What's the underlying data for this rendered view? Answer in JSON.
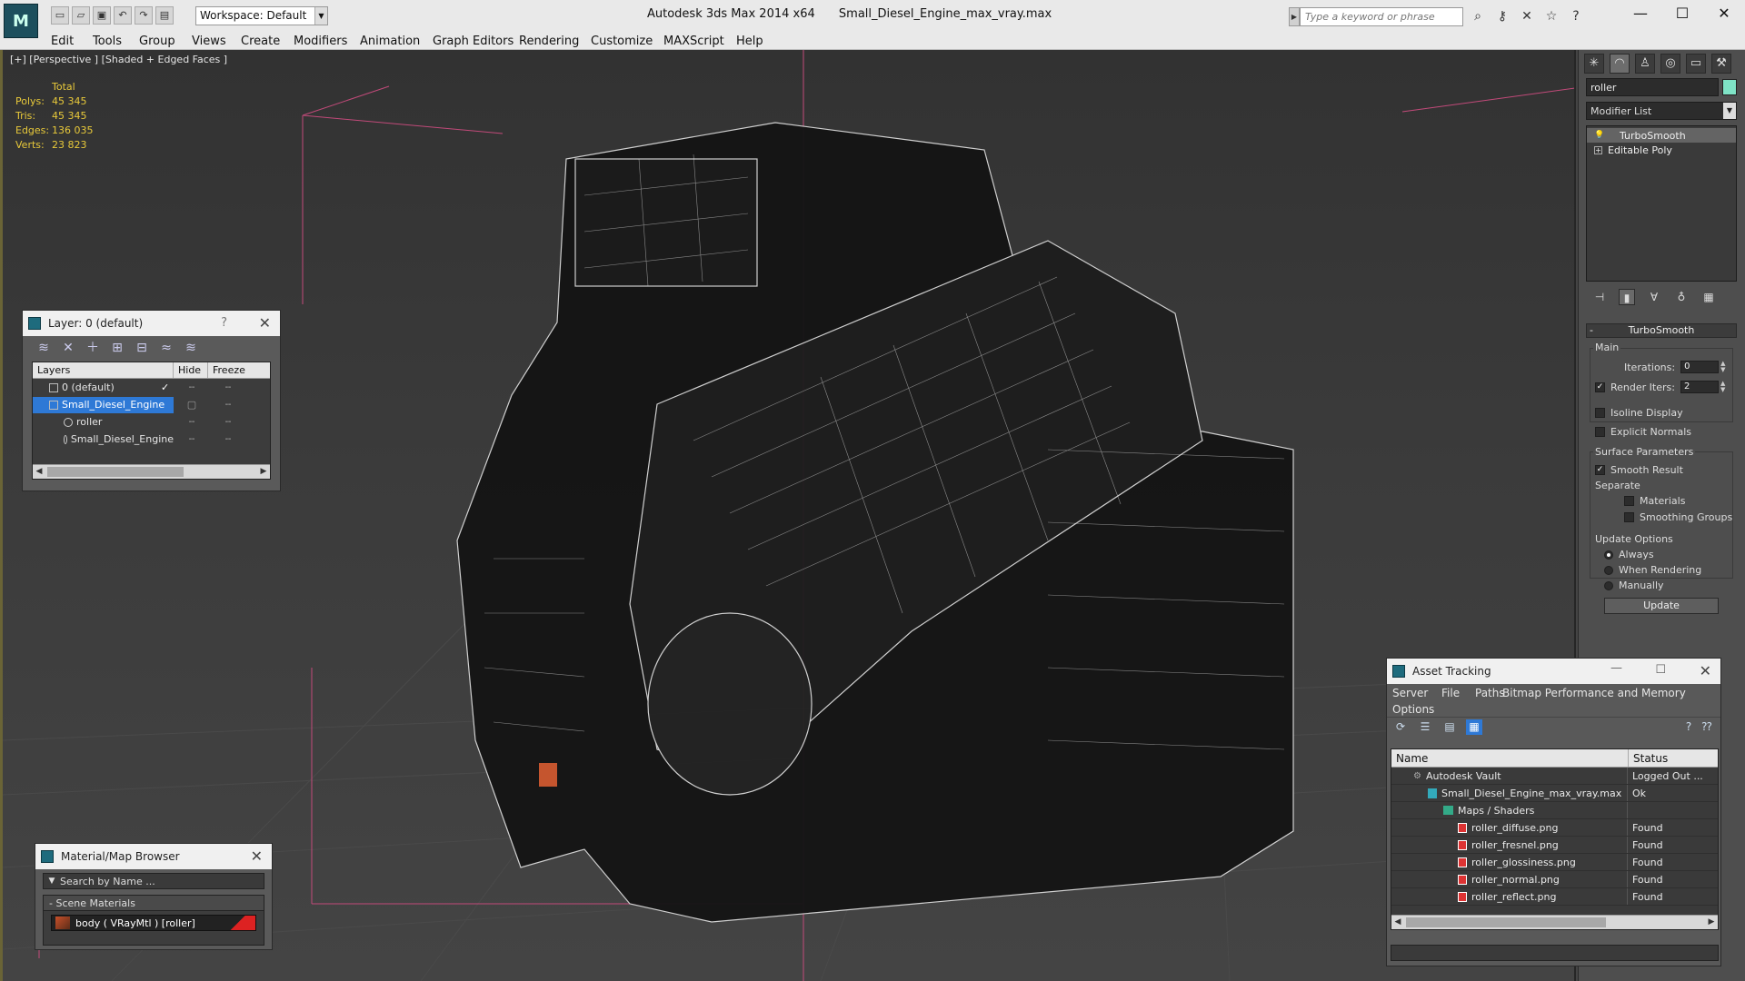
{
  "titlebar": {
    "workspace": "Workspace: Default",
    "app_title": "Autodesk 3ds Max  2014 x64",
    "file_title": "Small_Diesel_Engine_max_vray.max",
    "search_placeholder": "Type a keyword or phrase"
  },
  "menu": [
    "Edit",
    "Tools",
    "Group",
    "Views",
    "Create",
    "Modifiers",
    "Animation",
    "Graph Editors",
    "Rendering",
    "Customize",
    "MAXScript",
    "Help"
  ],
  "viewport": {
    "label": "[+] [Perspective ] [Shaded + Edged Faces ]",
    "stats": {
      "header": "Total",
      "polys_label": "Polys:",
      "polys": "45 345",
      "tris_label": "Tris:",
      "tris": "45 345",
      "edges_label": "Edges:",
      "edges": "136 035",
      "verts_label": "Verts:",
      "verts": "23 823"
    }
  },
  "layer_panel": {
    "title": "Layer: 0 (default)",
    "help": "?",
    "col_layers": "Layers",
    "col_hide": "Hide",
    "col_freeze": "Freeze",
    "rows": [
      {
        "name": "0 (default)"
      },
      {
        "name": "Small_Diesel_Engine"
      },
      {
        "name": "roller"
      },
      {
        "name": "Small_Diesel_Engine"
      }
    ]
  },
  "material_browser": {
    "title": "Material/Map Browser",
    "search_placeholder": "Search by Name ...",
    "group": "Scene Materials",
    "item": "body  ( VRayMtl ) [roller]"
  },
  "command_panel": {
    "object_name": "roller",
    "modifier_list": "Modifier List",
    "stack": [
      "TurboSmooth",
      "Editable Poly"
    ],
    "rollout_title": "TurboSmooth",
    "main_label": "Main",
    "iterations_label": "Iterations:",
    "iterations_value": "0",
    "render_iters_label": "Render Iters:",
    "render_iters_value": "2",
    "isoline_label": "Isoline Display",
    "explicit_normals_label": "Explicit Normals",
    "surface_label": "Surface Parameters",
    "smooth_result_label": "Smooth Result",
    "separate_label": "Separate",
    "materials_label": "Materials",
    "smoothing_groups_label": "Smoothing Groups",
    "update_options_label": "Update Options",
    "always_label": "Always",
    "when_rendering_label": "When Rendering",
    "manually_label": "Manually",
    "update_button": "Update"
  },
  "asset_tracking": {
    "title": "Asset Tracking",
    "menu": [
      "Server",
      "File",
      "Paths",
      "Bitmap Performance and Memory",
      "Options"
    ],
    "col_name": "Name",
    "col_status": "Status",
    "rows": [
      {
        "name": "Autodesk Vault",
        "status": "Logged Out ..."
      },
      {
        "name": "Small_Diesel_Engine_max_vray.max",
        "status": "Ok"
      },
      {
        "name": "Maps / Shaders",
        "status": ""
      },
      {
        "name": "roller_diffuse.png",
        "status": "Found"
      },
      {
        "name": "roller_fresnel.png",
        "status": "Found"
      },
      {
        "name": "roller_glossiness.png",
        "status": "Found"
      },
      {
        "name": "roller_normal.png",
        "status": "Found"
      },
      {
        "name": "roller_reflect.png",
        "status": "Found"
      }
    ]
  },
  "icons": {
    "app": "3ds-max-logo-icon",
    "quick_access": [
      "new-icon",
      "open-icon",
      "save-icon",
      "undo-icon",
      "redo-icon",
      "project-icon"
    ]
  }
}
